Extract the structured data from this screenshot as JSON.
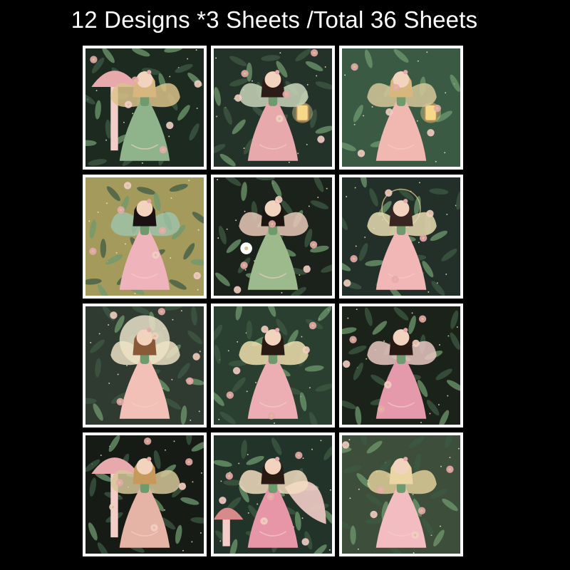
{
  "title": "12 Designs *3 Sheets /Total 36 Sheets",
  "palette": {
    "background": "#000000",
    "frame": "#ffffff",
    "forest_dark": "#1f2a22",
    "forest_mid": "#3d5a43",
    "leaf": "#6f9a6e",
    "pink": "#e8a9ac",
    "pink_light": "#f3cdc8",
    "gold": "#d9c38a",
    "skin": "#f2d3bd",
    "hair_dark": "#2c1c18",
    "hair_light": "#d8b77f"
  },
  "designs": [
    {
      "scene": "mushroom-fairy",
      "bg": "#1c2a20",
      "dress": "#8fb48c",
      "hair": "#d8b77f",
      "wing": "#d9c38a",
      "prop": "mushroom"
    },
    {
      "scene": "lantern-fairy",
      "bg": "#24332a",
      "dress": "#e8a9ac",
      "hair": "#2c1c18",
      "wing": "#c9d5b9",
      "prop": "lantern"
    },
    {
      "scene": "lantern-fairy-light",
      "bg": "#3b5a44",
      "dress": "#f0b8b0",
      "hair": "#d8b77f",
      "wing": "#d6c79a",
      "prop": "lantern"
    },
    {
      "scene": "gold-garden-fairy",
      "bg": "#a39a5c",
      "dress": "#efb3bb",
      "hair": "#1a1212",
      "wing": "#9fc3a8",
      "prop": "none"
    },
    {
      "scene": "portrait-fairy",
      "bg": "#1b221b",
      "dress": "#9cba8c",
      "hair": "#1d1512",
      "wing": "#e7c9b8",
      "prop": "flowers"
    },
    {
      "scene": "halo-fairy",
      "bg": "#23302a",
      "dress": "#f1b6b6",
      "hair": "#3a2620",
      "wing": "#e8dcb0",
      "prop": "halo"
    },
    {
      "scene": "moon-fairy",
      "bg": "#2f3b31",
      "dress": "#f2c0b6",
      "hair": "#8a5a38",
      "wing": "#ece2c4",
      "prop": "moon"
    },
    {
      "scene": "leaf-fairy",
      "bg": "#2a3f30",
      "dress": "#ecaeb2",
      "hair": "#2a1a14",
      "wing": "#f0dfae",
      "prop": "none"
    },
    {
      "scene": "ruffle-fairy",
      "bg": "#1a2219",
      "dress": "#e49aab",
      "hair": "#2a1a14",
      "wing": "#eac8c2",
      "prop": "none"
    },
    {
      "scene": "mushroom-fairy-night",
      "bg": "#161b15",
      "dress": "#e6b4a6",
      "hair": "#c79a5c",
      "wing": "#d6c79a",
      "prop": "mushroom"
    },
    {
      "scene": "shell-fairy",
      "bg": "#22342a",
      "dress": "#e796a8",
      "hair": "#2a1a14",
      "wing": "#f2ddc0",
      "prop": "shell"
    },
    {
      "scene": "blonde-fairy",
      "bg": "#3d4e3a",
      "dress": "#f3bcc0",
      "hair": "#ead5a3",
      "wing": "#dfcf9b",
      "prop": "none"
    }
  ]
}
